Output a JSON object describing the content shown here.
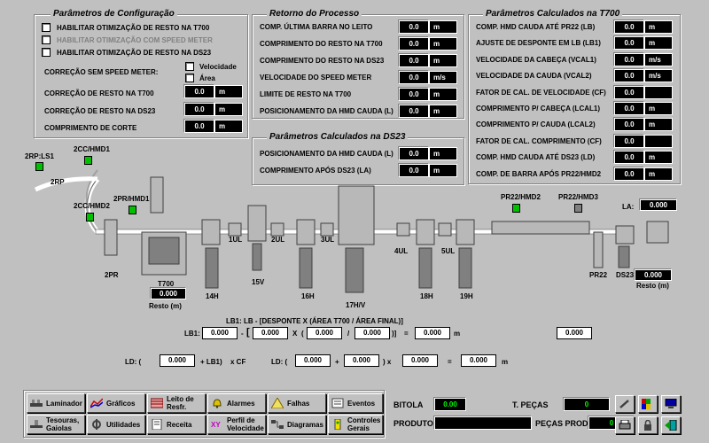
{
  "config": {
    "title": "Parâmetros de Configuração",
    "opt1": "HABILITAR OTIMIZAÇÃO DE RESTO NA T700",
    "opt2": "HABILITAR OTIMIZAÇÃO COM SPEED METER",
    "opt3": "HABILITAR OTIMIZAÇÃO DE RESTO NA DS23",
    "correcao_label": "CORREÇÃO SEM SPEED METER:",
    "velocidade": "Velocidade",
    "area": "Área",
    "corr_t700_label": "CORREÇÃO DE RESTO NA T700",
    "corr_t700_val": "0.0",
    "corr_ds23_label": "CORREÇÃO DE RESTO NA DS23",
    "corr_ds23_val": "0.0",
    "comp_corte_label": "COMPRIMENTO DE CORTE",
    "comp_corte_val": "0.0",
    "unit_m": "m"
  },
  "retorno": {
    "title": "Retorno do Processo",
    "rows": [
      {
        "label": "COMP. ÚLTIMA BARRA NO LEITO",
        "value": "0.0",
        "unit": "m"
      },
      {
        "label": "COMPRIMENTO DO RESTO NA T700",
        "value": "0.0",
        "unit": "m"
      },
      {
        "label": "COMPRIMENTO DO RESTO NA DS23",
        "value": "0.0",
        "unit": "m"
      },
      {
        "label": "VELOCIDADE DO SPEED METER",
        "value": "0.0",
        "unit": "m/s"
      },
      {
        "label": "LIMITE DE RESTO NA T700",
        "value": "0.0",
        "unit": "m"
      },
      {
        "label": "POSICIONAMENTO DA HMD CAUDA (L)",
        "value": "0.0",
        "unit": "m"
      }
    ]
  },
  "ds23": {
    "title": "Parâmetros Calculados na DS23",
    "rows": [
      {
        "label": "POSICIONAMENTO DA HMD CAUDA (L)",
        "value": "0.0",
        "unit": "m"
      },
      {
        "label": "COMPRIMENTO APÓS DS23 (LA)",
        "value": "0.0",
        "unit": "m"
      }
    ]
  },
  "t700": {
    "title": "Parâmetros Calculados na T700",
    "rows": [
      {
        "label": "COMP. HMD CAUDA ATÉ PR22 (LB)",
        "value": "0.0",
        "unit": "m"
      },
      {
        "label": "AJUSTE DE DESPONTE EM LB (LB1)",
        "value": "0.0",
        "unit": "m"
      },
      {
        "label": "VELOCIDADE DA CABEÇA (VCAL1)",
        "value": "0.0",
        "unit": "m/s"
      },
      {
        "label": "VELOCIDADE DA CAUDA (VCAL2)",
        "value": "0.0",
        "unit": "m/s"
      },
      {
        "label": "FATOR DE CAL. DE VELOCIDADE (CF)",
        "value": "0.0",
        "unit": ""
      },
      {
        "label": "COMPRIMENTO P/ CABEÇA (LCAL1)",
        "value": "0.0",
        "unit": "m"
      },
      {
        "label": "COMPRIMENTO P/ CAUDA (LCAL2)",
        "value": "0.0",
        "unit": "m"
      },
      {
        "label": "FATOR DE CAL. COMPRIMENTO (CF)",
        "value": "0.0",
        "unit": ""
      },
      {
        "label": "COMP. HMD CAUDA ATÉ DS23 (LD)",
        "value": "0.0",
        "unit": "m"
      },
      {
        "label": "COMP. DE BARRA APÓS PR22/HMD2",
        "value": "0.0",
        "unit": "m"
      }
    ]
  },
  "process": {
    "labels": {
      "rp_ls1": "2RP:LS1",
      "cc_hmd1": "2CC/HMD1",
      "rp": "2RP",
      "cc_hmd2": "2CC/HMD2",
      "pr_hmd1": "2PR/HMD1",
      "pr": "2PR",
      "t700": "T700",
      "resto_m": "Resto (m)",
      "h14": "14H",
      "ul1": "1UL",
      "ul2": "2UL",
      "v15": "15V",
      "ul3": "3UL",
      "h16": "16H",
      "hv17": "17H/V",
      "ul4": "4UL",
      "ul5": "5UL",
      "h18": "18H",
      "h19": "19H",
      "pr22_hmd2": "PR22/HMD2",
      "pr22_hmd3": "PR22/HMD3",
      "la": "LA:",
      "pr22": "PR22",
      "ds23": "DS23",
      "resto_m2": "Resto (m)"
    },
    "t700_resto": "0.000",
    "la_value": "0.000",
    "ds23_resto": "0.000"
  },
  "formula": {
    "lb1_desc": "LB1: LB - [DESPONTE X (ÁREA T700 / ÁREA FINAL)]",
    "lb1_label": "LB1:",
    "lb1_v1": "0.000",
    "minus": "-",
    "bracket_open": "[",
    "lb1_v2": "0.000",
    "times": "X",
    "paren_open": "(",
    "lb1_v3": "0.000",
    "slash": "/",
    "lb1_v4": "0.000",
    "close": ")]",
    "equals": "=",
    "lb1_res": "0.000",
    "m": "m",
    "right_value": "0.000",
    "ld_label": "LD: (",
    "ld_v1": "0.000",
    "ld_plus": "+ LB1)",
    "ld_xcf": "x CF",
    "ld2_label": "LD: (",
    "ld_v2": "0.000",
    "ld_plus2": "+",
    "ld_v3": "0.000",
    "ld_close": ") x",
    "ld_v4": "0.000",
    "ld_eq": "=",
    "ld_res": "0.000",
    "ld_m": "m"
  },
  "toolbar": {
    "laminador": "Laminador",
    "graficos": "Gráficos",
    "leito": "Leito de Resfr.",
    "alarmes": "Alarmes",
    "falhas": "Falhas",
    "eventos": "Eventos",
    "tesouras": "Tesouras, Gaiolas",
    "utilidades": "Utilidades",
    "receita": "Receita",
    "perfil": "Perfil de Velocidade",
    "diagramas": "Diagramas",
    "controles": "Controles Gerais",
    "bitola_label": "BITOLA",
    "bitola_val": "0.00",
    "produto_label": "PRODUTO",
    "produto_val": "",
    "tpecas_label": "T. PEÇAS",
    "tpecas_val": "0",
    "pecasprod_label": "PEÇAS PROD.",
    "pecasprod_val": "0"
  },
  "colors": {
    "panel": "#c0c0c0",
    "value_bg": "#000000",
    "sensor_on": "#00c000"
  }
}
